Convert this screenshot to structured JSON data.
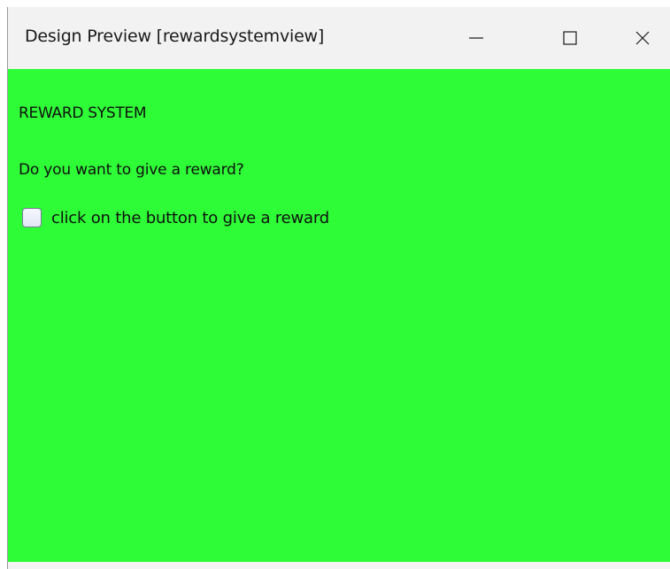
{
  "window": {
    "title": "Design Preview [rewardsystemview]"
  },
  "titlebar_buttons": {
    "minimize_icon": "minimize-icon",
    "maximize_icon": "maximize-icon",
    "close_icon": "close-icon"
  },
  "content": {
    "background_color": "#2efc36",
    "heading": "REWARD SYSTEM",
    "question": "Do you want to give a reward?",
    "checkbox": {
      "label": "click on the button to give a reward",
      "checked": false
    }
  }
}
